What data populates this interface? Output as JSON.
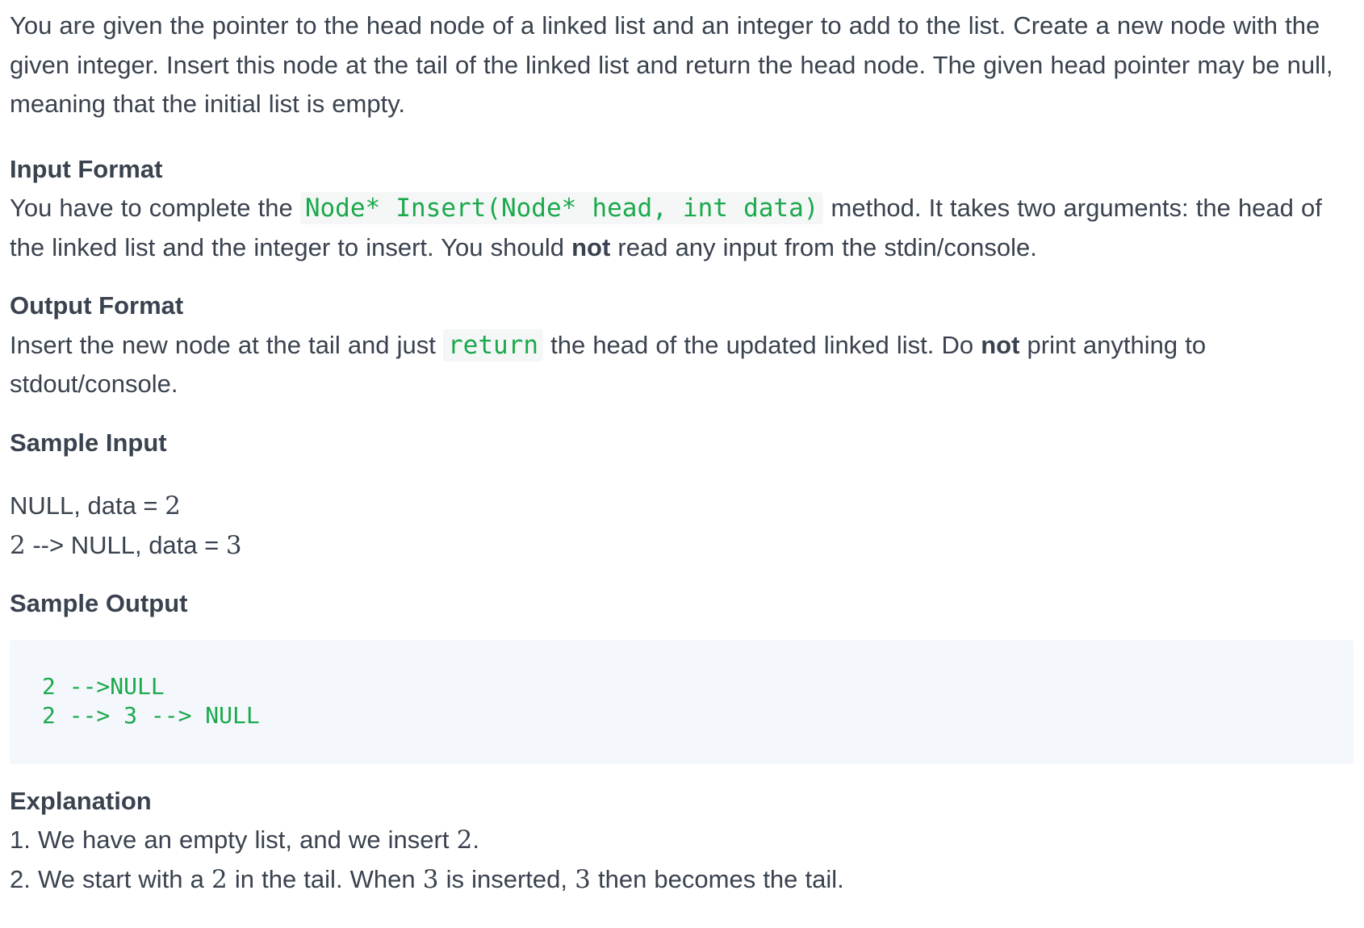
{
  "intro": {
    "text": "You are given the pointer to the head node of a linked list and an integer to add to the list. Create a new node with the given integer. Insert this node at the tail of the linked list and return the head node. The given head pointer may be null, meaning that the initial list is empty."
  },
  "input_format": {
    "heading": "Input Format",
    "text_before": "You have to complete the ",
    "code": "Node* Insert(Node* head, int data)",
    "text_after": " method. It takes two arguments: the head of the linked list and the integer to insert. You should ",
    "bold": "not",
    "text_end": " read any input from the stdin/console."
  },
  "output_format": {
    "heading": "Output Format",
    "text_before": "Insert the new node at the tail and just ",
    "code": "return",
    "text_after": " the head of the updated linked list. Do ",
    "bold": "not",
    "text_end": " print anything to stdout/console."
  },
  "sample_input": {
    "heading": "Sample Input",
    "line1_text": "NULL, data = ",
    "line1_num": "2",
    "line2_num": "2",
    "line2_text": " --> NULL, data = ",
    "line2_num2": "3"
  },
  "sample_output": {
    "heading": "Sample Output",
    "lines": [
      "2 -->NULL",
      "2 --> 3 --> NULL"
    ]
  },
  "explanation": {
    "heading": "Explanation",
    "item1_text": "1. We have an empty list, and we insert ",
    "item1_num": "2",
    "item1_end": ".",
    "item2_text": "2. We start with a ",
    "item2_num1": "2",
    "item2_mid": " in the tail. When ",
    "item2_num2": "3",
    "item2_mid2": " is inserted, ",
    "item2_num3": "3",
    "item2_end": " then becomes the tail."
  },
  "colors": {
    "text": "#39424e",
    "code": "#1ba94c",
    "code_bg": "#f4f7fc"
  }
}
